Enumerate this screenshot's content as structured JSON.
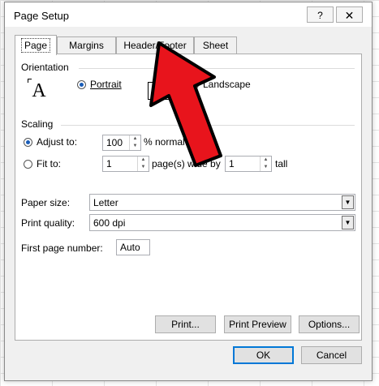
{
  "window": {
    "title": "Page Setup",
    "help_label": "?",
    "close_label": "✕"
  },
  "tabs": [
    {
      "label": "Page",
      "active": true
    },
    {
      "label": "Margins",
      "active": false
    },
    {
      "label": "Header/Footer",
      "active": false
    },
    {
      "label": "Sheet",
      "active": false
    }
  ],
  "orientation": {
    "heading": "Orientation",
    "portrait_icon_letter": "A",
    "portrait_label": "Portrait",
    "portrait_checked": true,
    "landscape_label": "Landscape",
    "landscape_checked": false
  },
  "scaling": {
    "heading": "Scaling",
    "adjust_label": "Adjust to:",
    "adjust_value": "100",
    "adjust_suffix": "% normal size",
    "adjust_checked": true,
    "fit_label": "Fit to:",
    "fit_wide_value": "1",
    "fit_wide_suffix": "page(s) wide by",
    "fit_tall_value": "1",
    "fit_tall_suffix": "tall",
    "fit_checked": false
  },
  "paper_size": {
    "label": "Paper size:",
    "value": "Letter"
  },
  "print_quality": {
    "label": "Print quality:",
    "value": "600 dpi"
  },
  "first_page": {
    "label": "First page number:",
    "value": "Auto"
  },
  "buttons": {
    "print": "Print...",
    "print_preview": "Print Preview",
    "options": "Options...",
    "ok": "OK",
    "cancel": "Cancel"
  },
  "annotation": {
    "arrow_color": "#e8141c",
    "arrow_outline": "#000000"
  }
}
